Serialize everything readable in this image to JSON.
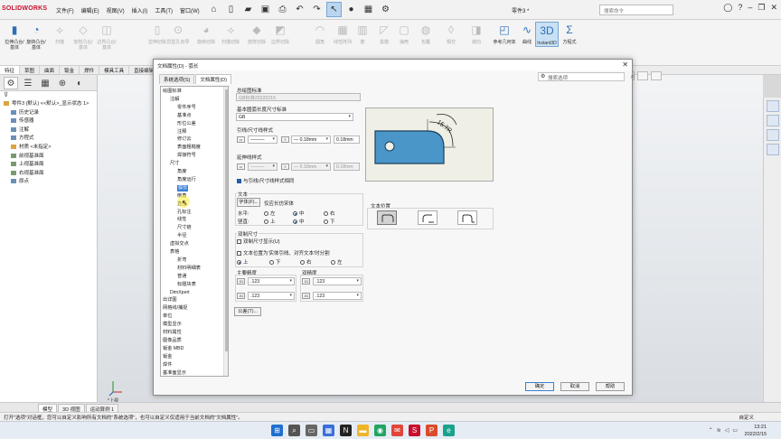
{
  "app": {
    "logo": "SOLIDWORKS",
    "menu": [
      "文件(F)",
      "编辑(E)",
      "视图(V)",
      "插入(I)",
      "工具(T)",
      "窗口(W)"
    ],
    "doc_title": "零件3 *",
    "search_placeholder": "搜索命令"
  },
  "commands": [
    {
      "label": "拉伸凸台/基体",
      "state": "on"
    },
    {
      "label": "旋转凸台/基体",
      "state": "on"
    },
    {
      "label": "扫描",
      "state": "dis"
    },
    {
      "label": "放样凸台/基体",
      "state": "dis"
    },
    {
      "label": "边界凸台/基体",
      "state": "dis"
    },
    {
      "label": "拉伸切除",
      "state": "dis"
    },
    {
      "label": "异型孔向导",
      "state": "dis"
    },
    {
      "label": "旋转切除",
      "state": "dis"
    },
    {
      "label": "扫描切除",
      "state": "dis"
    },
    {
      "label": "放样切除",
      "state": "dis"
    },
    {
      "label": "边界切除",
      "state": "dis"
    },
    {
      "label": "圆角",
      "state": "dis"
    },
    {
      "label": "线性阵列",
      "state": "dis"
    },
    {
      "label": "筋",
      "state": "dis"
    },
    {
      "label": "拔模",
      "state": "dis"
    },
    {
      "label": "抽壳",
      "state": "dis"
    },
    {
      "label": "包覆",
      "state": "dis"
    },
    {
      "label": "相交",
      "state": "dis"
    },
    {
      "label": "镜向",
      "state": "dis"
    },
    {
      "label": "参考几何体",
      "state": "on"
    },
    {
      "label": "曲线",
      "state": "on"
    },
    {
      "label": "Instant3D",
      "state": "active"
    },
    {
      "label": "方程式",
      "state": "on"
    }
  ],
  "cm_tabs": [
    "特征",
    "草图",
    "曲面",
    "钣金",
    "焊件",
    "模具工具",
    "直接编辑"
  ],
  "feature_tree": {
    "root": "零件3 (默认) <<默认>_显示状态 1>",
    "items": [
      {
        "label": "历史记录",
        "kind": "b"
      },
      {
        "label": "传感器",
        "kind": "b"
      },
      {
        "label": "注解",
        "kind": "b"
      },
      {
        "label": "方程式",
        "kind": "b"
      },
      {
        "label": "材质 <未指定>",
        "kind": "o"
      },
      {
        "label": "前视基准面",
        "kind": "g"
      },
      {
        "label": "上视基准面",
        "kind": "g"
      },
      {
        "label": "右视基准面",
        "kind": "g"
      },
      {
        "label": "原点",
        "kind": "b"
      }
    ]
  },
  "view_label": "*上视",
  "model_tabs": [
    "模型",
    "3D 视图",
    "运动算例 1"
  ],
  "status": {
    "left": "打开\"选项\"对话框，您可以自定义影响所有文档的\"系统选项\"，也可以自定义仅适用于当前文档的\"文档属性\"。",
    "right": "自定义"
  },
  "clock": {
    "time": "13:21",
    "date": "2022/2/15"
  },
  "dialog": {
    "title": "文档属性(D) - 弧长",
    "tabs": [
      "系统选项(S)",
      "文档属性(D)"
    ],
    "search_placeholder": "搜索选项",
    "tree": [
      {
        "label": "绘图标准",
        "indent": 0
      },
      {
        "label": "注解",
        "indent": 1
      },
      {
        "label": "零件序号",
        "indent": 2
      },
      {
        "label": "基准点",
        "indent": 2
      },
      {
        "label": "形位公差",
        "indent": 2
      },
      {
        "label": "注释",
        "indent": 2
      },
      {
        "label": "修订云",
        "indent": 2
      },
      {
        "label": "表面粗糙度",
        "indent": 2
      },
      {
        "label": "焊接符号",
        "indent": 2
      },
      {
        "label": "尺寸",
        "indent": 1
      },
      {
        "label": "角度",
        "indent": 2
      },
      {
        "label": "角度运行",
        "indent": 2
      },
      {
        "label": "弧长",
        "indent": 2,
        "selected": true
      },
      {
        "label": "倒角",
        "indent": 2
      },
      {
        "label": "直径",
        "indent": 2
      },
      {
        "label": "孔标注",
        "indent": 2
      },
      {
        "label": "线性",
        "indent": 2
      },
      {
        "label": "尺寸链",
        "indent": 2
      },
      {
        "label": "半径",
        "indent": 2
      },
      {
        "label": "虚拟交点",
        "indent": 1
      },
      {
        "label": "表格",
        "indent": 1
      },
      {
        "label": "折弯",
        "indent": 2
      },
      {
        "label": "材料明细表",
        "indent": 2
      },
      {
        "label": "普通",
        "indent": 2
      },
      {
        "label": "标题块表",
        "indent": 2
      },
      {
        "label": "DimXpert",
        "indent": 1
      },
      {
        "label": "出详图",
        "indent": 0
      },
      {
        "label": "网格线/捕捉",
        "indent": 0
      },
      {
        "label": "单位",
        "indent": 0
      },
      {
        "label": "模型显示",
        "indent": 0
      },
      {
        "label": "材料属性",
        "indent": 0
      },
      {
        "label": "图像品质",
        "indent": 0
      },
      {
        "label": "钣金 MBD",
        "indent": 0
      },
      {
        "label": "钣金",
        "indent": 0
      },
      {
        "label": "焊件",
        "indent": 0
      },
      {
        "label": "基准面显示",
        "indent": 0
      }
    ],
    "overall_standard_label": "总绘图标准",
    "overall_standard_value": "GB标准20220215",
    "base_standard_label": "基本圆弧长度尺寸标准",
    "base_standard_value": "GB",
    "leader_label": "引线/尺寸线样式",
    "leader_thickness": "0.18mm",
    "leader_custom": "0.18mm",
    "ext_label": "延伸线样式",
    "ext_thickness": "0.18mm",
    "ext_custom": "0.18mm",
    "same_as_leader": "与引线/尺寸线样式相同",
    "text_label": "文本",
    "font_button": "字体(F)...",
    "only_dim_text": "仅应长仿宋体",
    "horiz_label": "水平:",
    "vert_label": "竖直:",
    "h_opts": [
      "左",
      "中",
      "右"
    ],
    "v_opts": [
      "上",
      "中",
      "下"
    ],
    "text_pos_label": "文本位置",
    "dual_label": "双制尺寸",
    "dual_show": "双制尺寸显示(U)",
    "split_text": "文本位置为'实体引线、对齐文本'时分割",
    "split_opts": [
      "上",
      "下",
      "右",
      "左"
    ],
    "primary_label": "主要精度",
    "dual_prec_label": "双精度",
    "precision_value": ".123",
    "tolerance_button": "公差(T)...",
    "ok": "确定",
    "cancel": "取消",
    "help": "帮助",
    "preview_dim": "15.7R"
  }
}
